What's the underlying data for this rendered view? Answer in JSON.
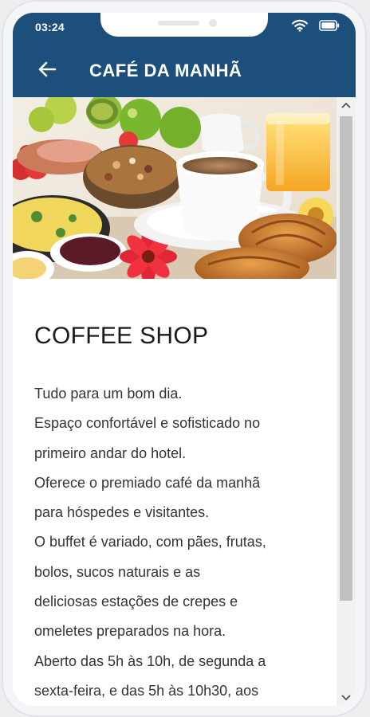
{
  "status_bar": {
    "time": "03:24",
    "icons": [
      "wifi-icon",
      "battery-icon"
    ]
  },
  "header": {
    "back_icon": "arrow-left-icon",
    "title": "CAFÉ DA MANHÃ",
    "background_color": "#1d4f7c"
  },
  "hero_image": {
    "subject": "breakfast-table-photo"
  },
  "article": {
    "heading": "COFFEE SHOP",
    "lines": [
      "Tudo para um bom dia.",
      "Espaço confortável e sofisticado no",
      "primeiro andar do hotel.",
      "Oferece o premiado café da manhã",
      "para hóspedes e visitantes.",
      "O buffet é variado, com pães, frutas,",
      "bolos, sucos naturais e as",
      "deliciosas estações de crepes e",
      "omeletes preparados na hora.",
      "Aberto das 5h às 10h, de segunda a",
      "sexta-feira, e das 5h às 10h30, aos"
    ]
  },
  "scrollbar": {
    "up_icon": "chevron-up-icon",
    "down_icon": "chevron-down-icon"
  }
}
